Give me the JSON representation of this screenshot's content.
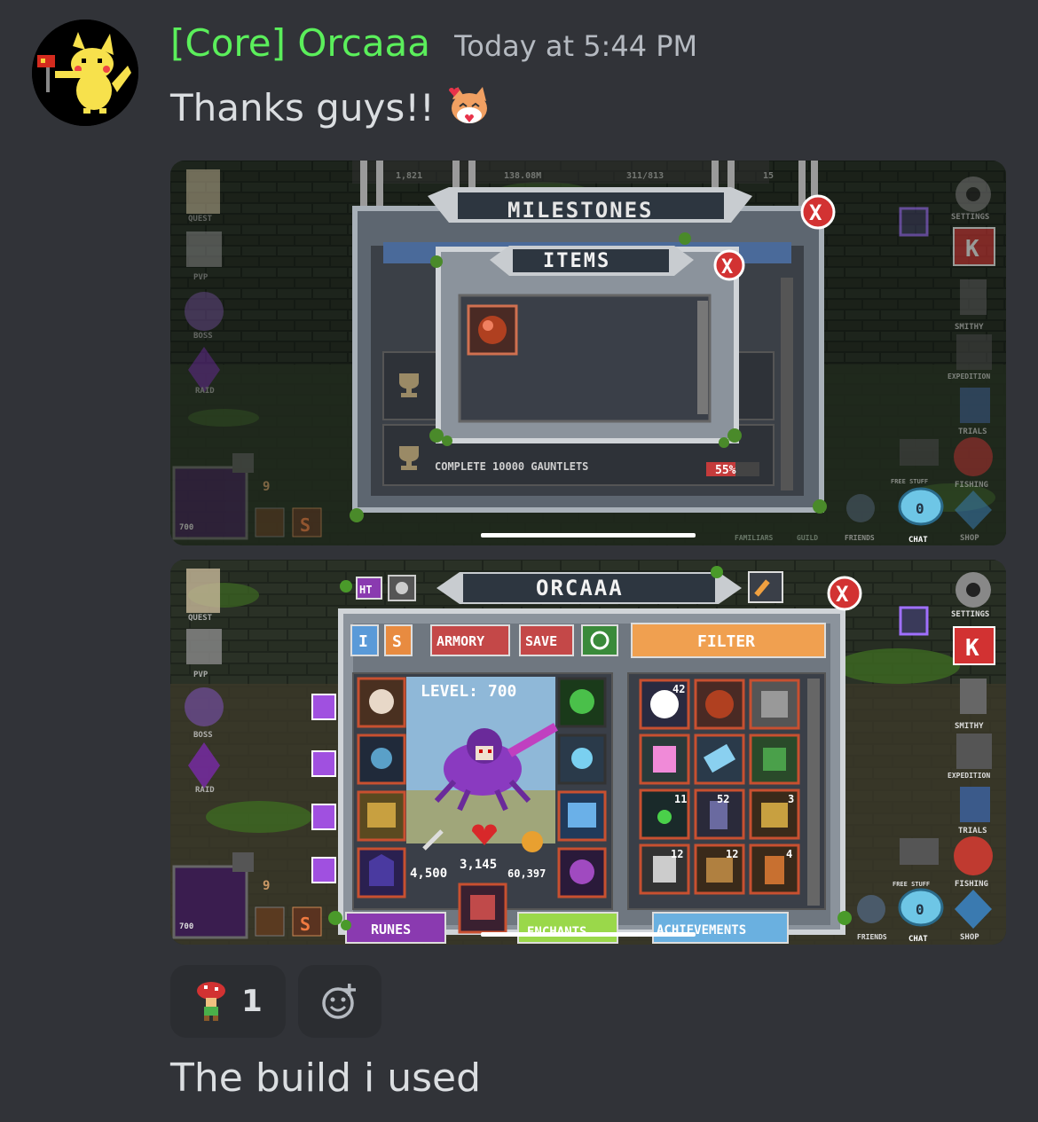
{
  "message": {
    "username": "[Core] Orcaaa",
    "timestamp": "Today at 5:44 PM",
    "text": "Thanks guys!!",
    "followup_text": "The build i used"
  },
  "reaction": {
    "count": "1"
  },
  "screenshot1": {
    "top_bar": {
      "stat1": "1,821",
      "gold": "138.08M",
      "gems": "311/813",
      "keys": "15"
    },
    "window_title": "MILESTONES",
    "dialog_title": "ITEMS",
    "milestone_text": "COMPLETE 10000 GAUNTLETS",
    "milestone_progress": "55%",
    "left_nav": [
      "QUEST",
      "PVP",
      "BOSS",
      "RAID"
    ],
    "right_nav": [
      "SETTINGS",
      "SMITHY",
      "EXPEDITION",
      "TRIALS",
      "FISHING",
      "SHOP"
    ],
    "bottom_nav": [
      "FREE STUFF",
      "FAMILIARS",
      "GUILD",
      "FRIENDS",
      "CHAT"
    ],
    "level_badge": "700",
    "slot_badge": "9",
    "s_badge": "S"
  },
  "screenshot2": {
    "window_title": "ORCAAA",
    "tabs": {
      "ht": "HT",
      "i": "I",
      "s": "S",
      "armory": "ARMORY",
      "save": "SAVE",
      "filter": "FILTER"
    },
    "level": "LEVEL: 700",
    "stats": {
      "attack": "4,500",
      "health": "3,145",
      "speed": "60,397"
    },
    "bottom_tabs": [
      "RUNES",
      "ENCHANTS",
      "ACHIEVEMENTS"
    ],
    "inventory_counts": [
      "42",
      "11",
      "52",
      "3",
      "12",
      "12",
      "4"
    ],
    "left_nav": [
      "QUEST",
      "PVP",
      "BOSS",
      "RAID"
    ],
    "right_nav": [
      "SETTINGS",
      "SMITHY",
      "EXPEDITION",
      "TRIALS",
      "FISHING",
      "SHOP"
    ],
    "bottom_nav": [
      "FREE STUFF",
      "FRIENDS",
      "CHAT"
    ],
    "level_badge": "700",
    "slot_badge": "9",
    "s_badge": "S"
  },
  "colors": {
    "background": "#313338",
    "username": "#5bef5b",
    "timestamp": "#b5bac1",
    "text": "#dbdee1",
    "pill": "#2b2d31"
  }
}
